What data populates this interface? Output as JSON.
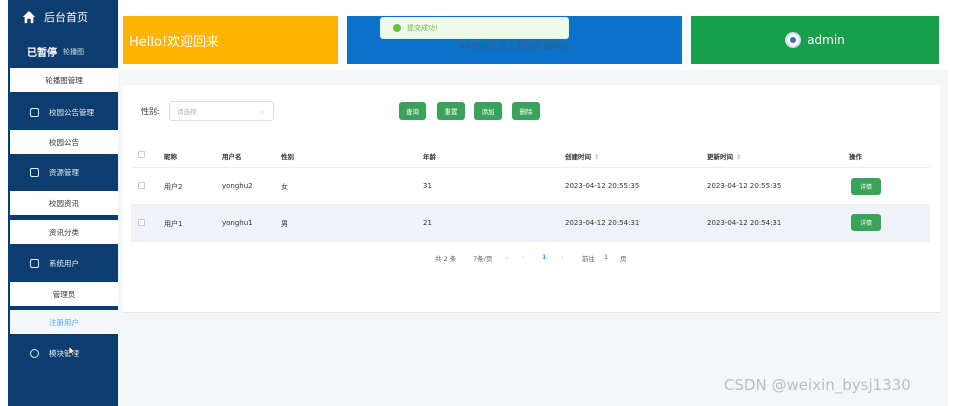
{
  "sidebar": {
    "home_label": "后台首页",
    "paused_label": "已暂停",
    "paused_sub": "轮播图",
    "groups": [
      {
        "label": "校园公告管理"
      },
      {
        "label": "资源管理"
      },
      {
        "label": "系统用户"
      },
      {
        "label": "模块管理"
      }
    ],
    "items": [
      {
        "label": "轮播图管理"
      },
      {
        "label": "校园公告"
      },
      {
        "label": "校园资讯"
      },
      {
        "label": "资讯分类"
      },
      {
        "label": "管理员"
      },
      {
        "label": "注册用户"
      }
    ]
  },
  "cards": {
    "welcome": "Hello!欢迎回来",
    "blue_text": "XX校园生活工具的前端网站",
    "user": "admin"
  },
  "toast": {
    "message": "提交成功!"
  },
  "filter": {
    "label": "性别:",
    "placeholder": "请选择",
    "buttons": [
      "查询",
      "重置",
      "添加",
      "删除"
    ]
  },
  "table": {
    "headers": [
      "昵称",
      "用户名",
      "性别",
      "年龄",
      "创建时间",
      "更新时间",
      "操作"
    ],
    "rows": [
      {
        "nickname": "用户2",
        "username": "yonghu2",
        "gender": "女",
        "age": "31",
        "created": "2023-04-12 20:55:35",
        "updated": "2023-04-12 20:55:35",
        "action": "详情"
      },
      {
        "nickname": "用户1",
        "username": "yonghu1",
        "gender": "男",
        "age": "21",
        "created": "2023-04-12 20:54:31",
        "updated": "2023-04-12 20:54:31",
        "action": "详情"
      }
    ]
  },
  "pagination": {
    "total": "共 2 条",
    "page_size": "7条/页",
    "current_page": "1",
    "goto_label": "前往",
    "goto_value": "1",
    "page_suffix": "页"
  },
  "watermark": "CSDN @weixin_bysj1330"
}
